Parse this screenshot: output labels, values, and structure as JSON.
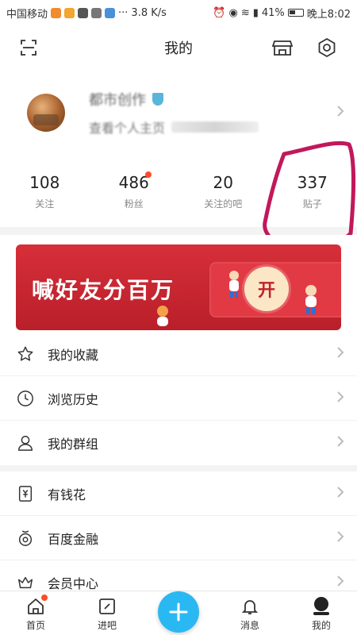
{
  "status_bar": {
    "carrier": "中国移动",
    "network_speed": "3.8 K/s",
    "battery": "41%",
    "time": "晚上8:02"
  },
  "header": {
    "title": "我的",
    "icons": [
      "scan-icon",
      "store-icon",
      "settings-icon"
    ]
  },
  "profile": {
    "username": "都市创作",
    "subtitle": "查看个人主页"
  },
  "stats": [
    {
      "value": "108",
      "label": "关注",
      "has_dot": false
    },
    {
      "value": "486",
      "label": "粉丝",
      "has_dot": true
    },
    {
      "value": "20",
      "label": "关注的吧",
      "has_dot": false
    },
    {
      "value": "337",
      "label": "贴子",
      "has_dot": false
    }
  ],
  "banner": {
    "text": "喊好友分百万",
    "open_label": "开",
    "bg_color": "#c92632"
  },
  "menu": {
    "group1": [
      {
        "icon": "star-icon",
        "label": "我的收藏"
      },
      {
        "icon": "clock-icon",
        "label": "浏览历史"
      },
      {
        "icon": "user-group-icon",
        "label": "我的群组"
      }
    ],
    "group2": [
      {
        "icon": "money-card-icon",
        "label": "有钱花"
      },
      {
        "icon": "finance-icon",
        "label": "百度金融"
      },
      {
        "icon": "crown-icon",
        "label": "会员中心"
      }
    ]
  },
  "bottom_nav": [
    {
      "icon": "home-icon",
      "label": "首页",
      "has_dot": true
    },
    {
      "icon": "edit-icon",
      "label": "进吧",
      "has_dot": false
    },
    {
      "icon": "plus-icon",
      "label": "",
      "has_dot": false
    },
    {
      "icon": "bell-icon",
      "label": "消息",
      "has_dot": false
    },
    {
      "icon": "profile-icon",
      "label": "我的",
      "has_dot": false
    }
  ],
  "colors": {
    "accent": "#2ab8f3",
    "notification_dot": "#ff4c2a",
    "highlight_ink": "#c2185b"
  }
}
